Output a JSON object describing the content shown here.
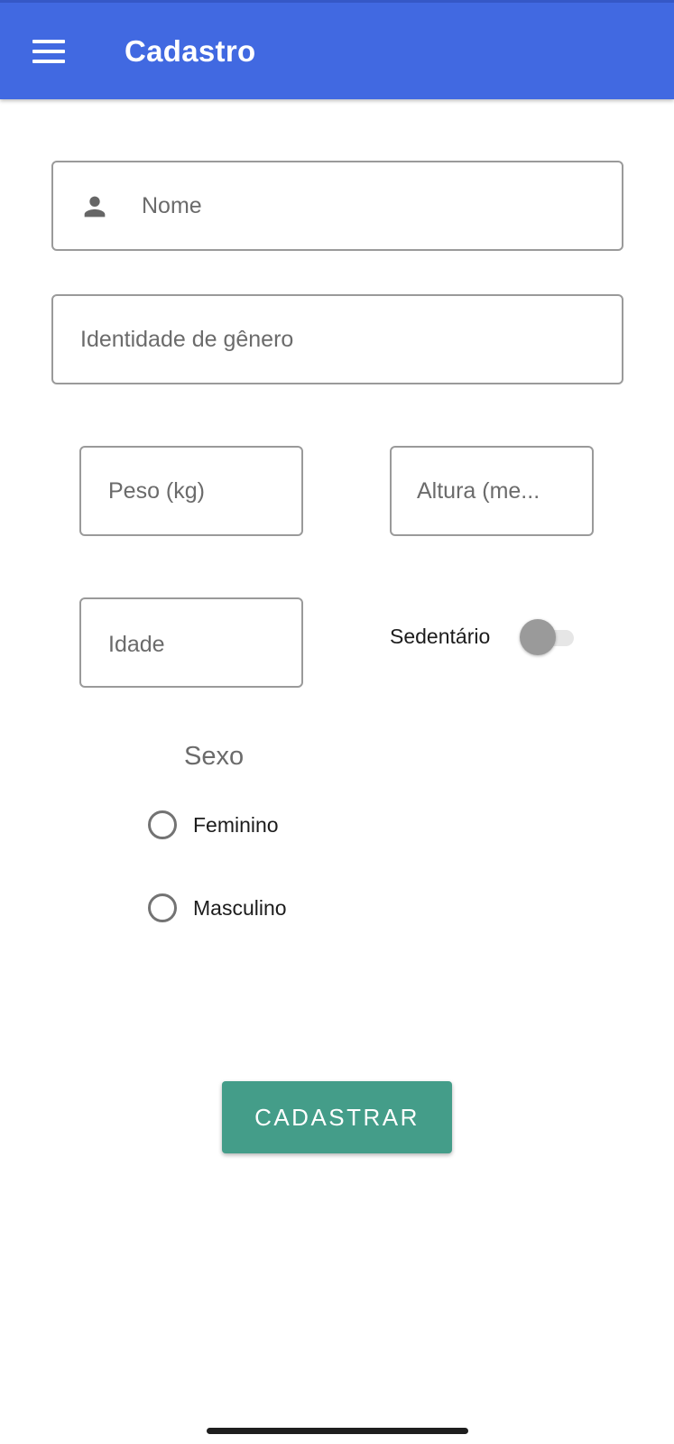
{
  "app_bar": {
    "title": "Cadastro",
    "icon": "menu-icon",
    "color": "#4169e1"
  },
  "form": {
    "nome": {
      "placeholder": "Nome",
      "icon": "person-icon",
      "value": ""
    },
    "identidade_genero": {
      "placeholder": "Identidade de gênero",
      "value": ""
    },
    "peso": {
      "placeholder": "Peso (kg)",
      "value": ""
    },
    "altura": {
      "placeholder": "Altura (me...",
      "value": ""
    },
    "idade": {
      "placeholder": "Idade",
      "value": ""
    },
    "sedentario": {
      "label": "Sedentário",
      "checked": false
    },
    "sexo": {
      "label": "Sexo",
      "options": [
        {
          "label": "Feminino",
          "selected": false
        },
        {
          "label": "Masculino",
          "selected": false
        }
      ]
    },
    "submit_label": "CADASTRAR",
    "submit_color": "#449d89"
  }
}
